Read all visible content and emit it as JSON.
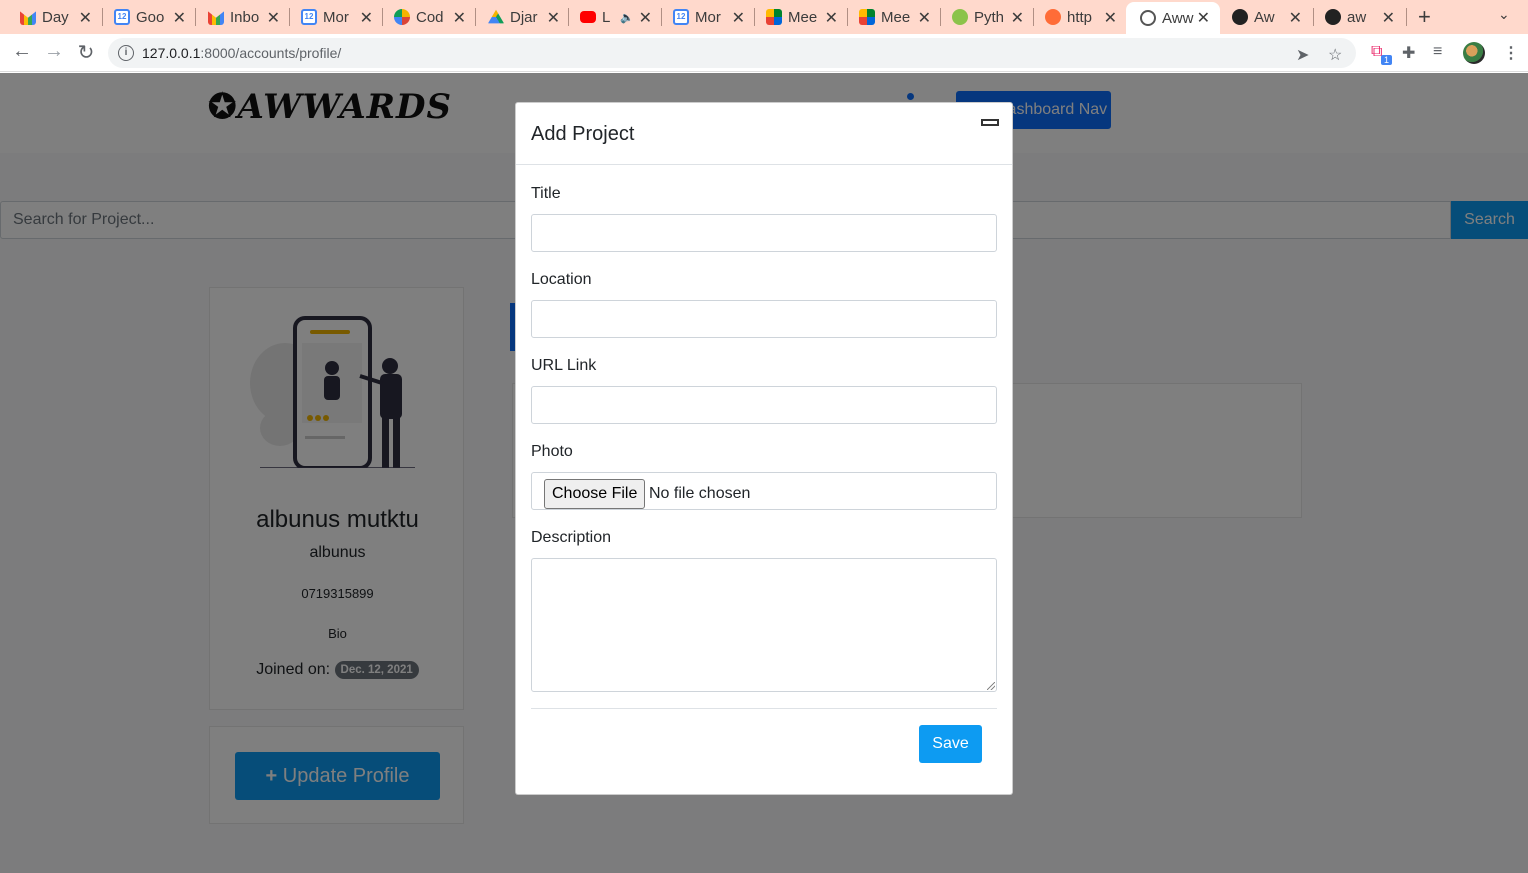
{
  "browser": {
    "tabs": [
      {
        "label": "Day",
        "icon": "gmail-icon"
      },
      {
        "label": "Goo",
        "icon": "google-calendar-icon"
      },
      {
        "label": "Inbo",
        "icon": "gmail-icon"
      },
      {
        "label": "Mor",
        "icon": "google-calendar-icon"
      },
      {
        "label": "Cod",
        "icon": "codewars-icon"
      },
      {
        "label": "Djar",
        "icon": "google-drive-icon"
      },
      {
        "label": "L",
        "icon": "youtube-icon"
      },
      {
        "label": "Mor",
        "icon": "google-calendar-icon"
      },
      {
        "label": "Mee",
        "icon": "google-meet-icon"
      },
      {
        "label": "Mee",
        "icon": "google-meet-icon"
      },
      {
        "label": "Pyth",
        "icon": "python-icon"
      },
      {
        "label": "http",
        "icon": "postman-icon"
      },
      {
        "label": "Aww",
        "icon": "globe-icon"
      },
      {
        "label": "Aw",
        "icon": "github-icon"
      },
      {
        "label": "aw",
        "icon": "github-icon"
      }
    ],
    "active_tab_index": 12,
    "url_host": "127.0.0.1",
    "url_path": ":8000/accounts/profile/",
    "extension_badge": "1"
  },
  "site": {
    "logo_text": "AWWARDS",
    "dashboard_button": "Dashboard Nav",
    "search_placeholder": "Search for Project...",
    "search_button": "Search"
  },
  "profile": {
    "full_name": "albunus mutktu",
    "username": "albunus",
    "phone": "0719315899",
    "bio": "Bio",
    "joined_label": "Joined on:",
    "joined_date": "Dec. 12, 2021",
    "update_button": "Update Profile"
  },
  "modal": {
    "title": "Add Project",
    "fields": {
      "title_label": "Title",
      "location_label": "Location",
      "url_label": "URL Link",
      "photo_label": "Photo",
      "description_label": "Description"
    },
    "file_button": "Choose File",
    "file_status": "No file chosen",
    "save_button": "Save"
  },
  "colors": {
    "accent": "#0d9bf2",
    "primary": "#0d6efd",
    "tab_strip": "#ffd9cc"
  }
}
